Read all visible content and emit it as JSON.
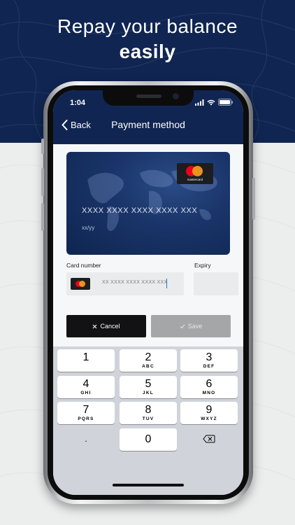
{
  "promo": {
    "line1": "Repay your balance",
    "line2": "easily"
  },
  "status_bar": {
    "time": "1:04"
  },
  "nav": {
    "back_label": "Back",
    "title": "Payment method"
  },
  "card": {
    "brand": "mastercard",
    "number_placeholder": "XXXX XXXX XXXX XXXX XXX",
    "expiry_placeholder": "xx/yy"
  },
  "form": {
    "card_number_label": "Card number",
    "expiry_label": "Expiry",
    "card_number_placeholder": "XX XXXX XXXX XXXX XXX",
    "expiry_value": ""
  },
  "actions": {
    "cancel_label": "Cancel",
    "save_label": "Save"
  },
  "keypad": {
    "keys": [
      {
        "digit": "1",
        "letters": ""
      },
      {
        "digit": "2",
        "letters": "ABC"
      },
      {
        "digit": "3",
        "letters": "DEF"
      },
      {
        "digit": "4",
        "letters": "GHI"
      },
      {
        "digit": "5",
        "letters": "JKL"
      },
      {
        "digit": "6",
        "letters": "MNO"
      },
      {
        "digit": "7",
        "letters": "PQRS"
      },
      {
        "digit": "8",
        "letters": "TUV"
      },
      {
        "digit": "9",
        "letters": "WXYZ"
      }
    ],
    "decimal": ".",
    "zero": "0",
    "delete_icon": "backspace-icon"
  },
  "colors": {
    "brand_navy": "#102551",
    "mastercard_red": "#eb001b",
    "mastercard_orange": "#f79e1b"
  }
}
